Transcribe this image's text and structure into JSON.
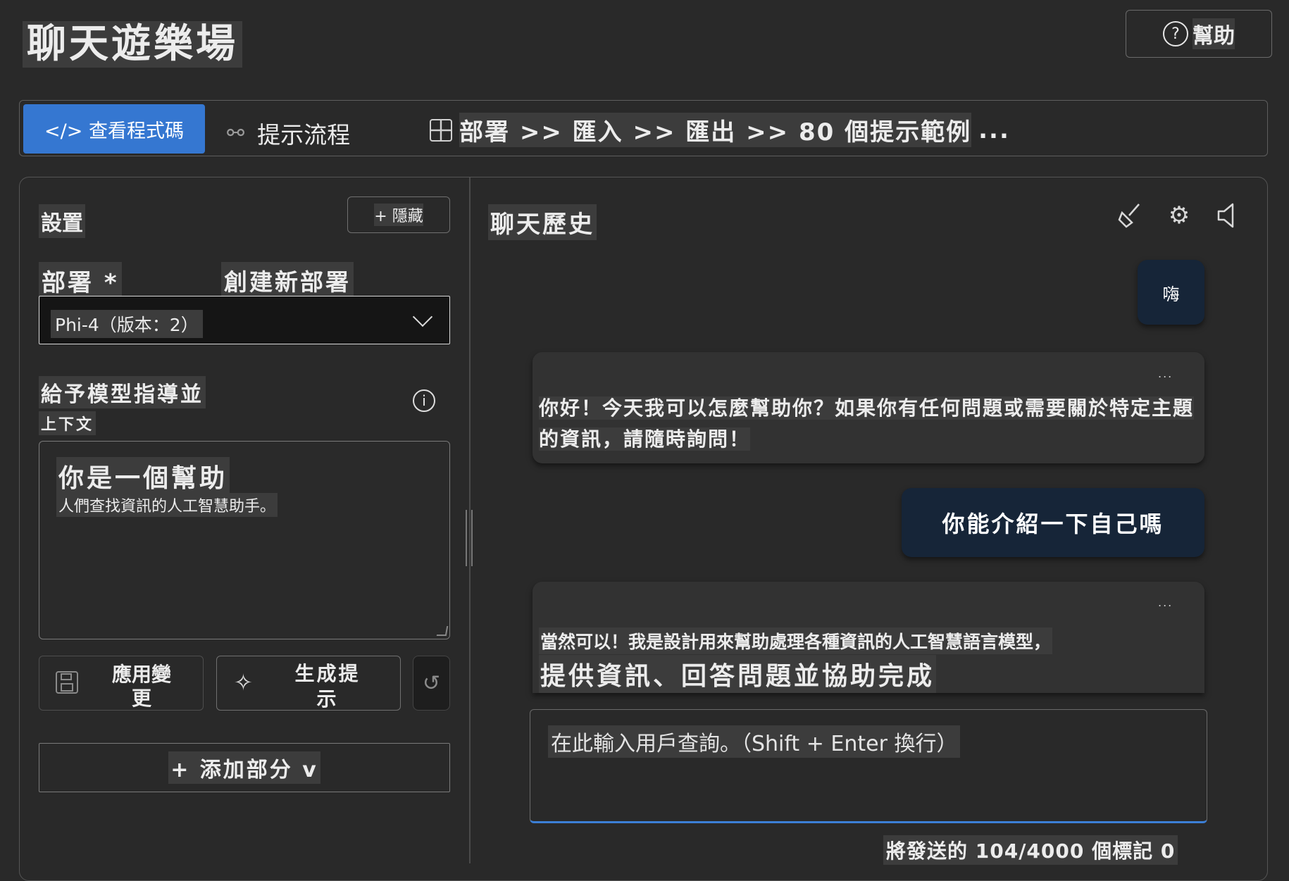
{
  "header": {
    "title": "聊天遊樂場",
    "help_label": "幫助"
  },
  "toolbar": {
    "view_code_label": "</> 查看程式碼",
    "prompt_flow_label": "提示流程",
    "deploy_chain_label": "部署 >> 匯入 >> 匯出 >> 80 個提示範例",
    "more_label": "..."
  },
  "settings": {
    "title": "設置",
    "hide_label": "+ 隱藏",
    "deployment_label": "部署 *",
    "create_deployment_label": "創建新部署",
    "deployment_value": "Phi-4（版本：2）",
    "guidance_title": "給予模型指導並",
    "guidance_subtitle": "上下文",
    "system_message_line1": "你是一個幫助",
    "system_message_line2": "人們查找資訊的人工智慧助手。",
    "apply_label": "應用變更",
    "generate_label": "生成提示",
    "add_section_label": "+ 添加部分 v"
  },
  "chat": {
    "title": "聊天歷史",
    "icons": [
      "broom-icon",
      "gear-icon",
      "speaker-icon"
    ],
    "messages": {
      "user1": "嗨",
      "ai1_menu": "...",
      "ai1": "你好！今天我可以怎麼幫助你？如果你有任何問題或需要關於特定主題的資訊，請隨時詢問！",
      "user2": "你能介紹一下自己嗎",
      "ai2_menu": "...",
      "ai2_line1": "當然可以！我是設計用來幫助處理各種資訊的人工智慧語言模型，",
      "ai2_line2": "提供資訊、回答問題並協助完成"
    },
    "input_placeholder": "在此輸入用戶查詢。（Shift + Enter 換行）",
    "token_count": "將發送的 104/4000 個標記 0"
  },
  "colors": {
    "background": "#292929",
    "accent": "#3577d1",
    "user_bubble": "#162538",
    "ai_bubble": "#323232"
  }
}
